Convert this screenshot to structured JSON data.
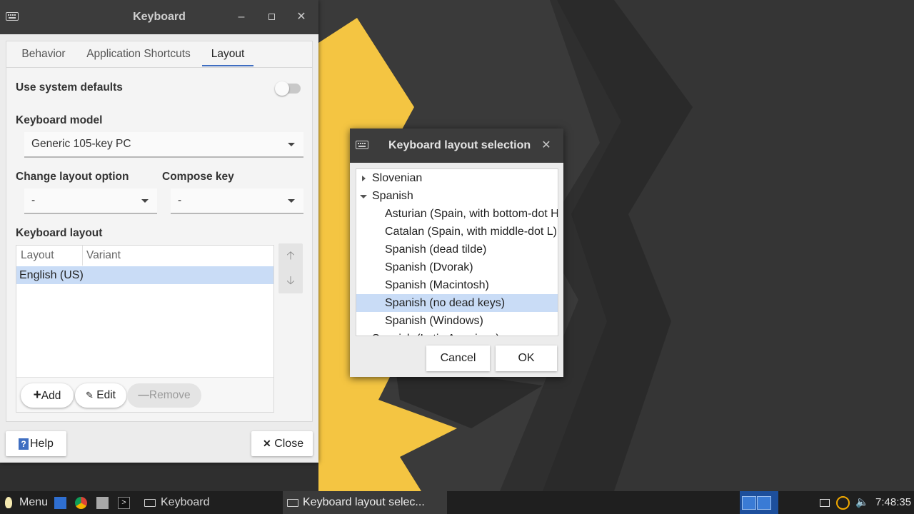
{
  "colors": {
    "accent": "#3f6ec1",
    "selection": "#c9dcf6",
    "titlebar": "#3c3c3c",
    "desktop_yellow": "#f4c542"
  },
  "keyboard_window": {
    "title": "Keyboard",
    "tabs": [
      "Behavior",
      "Application Shortcuts",
      "Layout"
    ],
    "active_tab": "Layout",
    "use_system_defaults_label": "Use system defaults",
    "use_system_defaults_on": false,
    "keyboard_model_label": "Keyboard model",
    "keyboard_model_value": "Generic 105-key PC",
    "change_layout_label": "Change layout option",
    "change_layout_value": "-",
    "compose_key_label": "Compose key",
    "compose_key_value": "-",
    "keyboard_layout_label": "Keyboard layout",
    "columns": [
      "Layout",
      "Variant"
    ],
    "rows": [
      {
        "layout": "English (US)",
        "variant": ""
      }
    ],
    "add_label": "Add",
    "edit_label": "Edit",
    "remove_label": "Remove",
    "help_label": "Help",
    "close_label": "Close"
  },
  "dialog": {
    "title": "Keyboard layout selection",
    "items": [
      {
        "label": "Slovenian",
        "indent": 0,
        "expander": "closed",
        "selected": false
      },
      {
        "label": "Spanish",
        "indent": 0,
        "expander": "open",
        "selected": false
      },
      {
        "label": "Asturian (Spain, with bottom-dot H",
        "indent": 1,
        "expander": "",
        "selected": false
      },
      {
        "label": "Catalan (Spain, with middle-dot L)",
        "indent": 1,
        "expander": "",
        "selected": false
      },
      {
        "label": "Spanish (dead tilde)",
        "indent": 1,
        "expander": "",
        "selected": false
      },
      {
        "label": "Spanish (Dvorak)",
        "indent": 1,
        "expander": "",
        "selected": false
      },
      {
        "label": "Spanish (Macintosh)",
        "indent": 1,
        "expander": "",
        "selected": false
      },
      {
        "label": "Spanish (no dead keys)",
        "indent": 1,
        "expander": "",
        "selected": true
      },
      {
        "label": "Spanish (Windows)",
        "indent": 1,
        "expander": "",
        "selected": false
      },
      {
        "label": "Spanish (Latin American)",
        "indent": 0,
        "expander": "closed",
        "selected": false
      }
    ],
    "cancel_label": "Cancel",
    "ok_label": "OK"
  },
  "taskbar": {
    "menu_label": "Menu",
    "tasks": [
      "Keyboard",
      "Keyboard layout selec..."
    ],
    "active_task": "Keyboard layout selec...",
    "clock": "7:48:35"
  }
}
